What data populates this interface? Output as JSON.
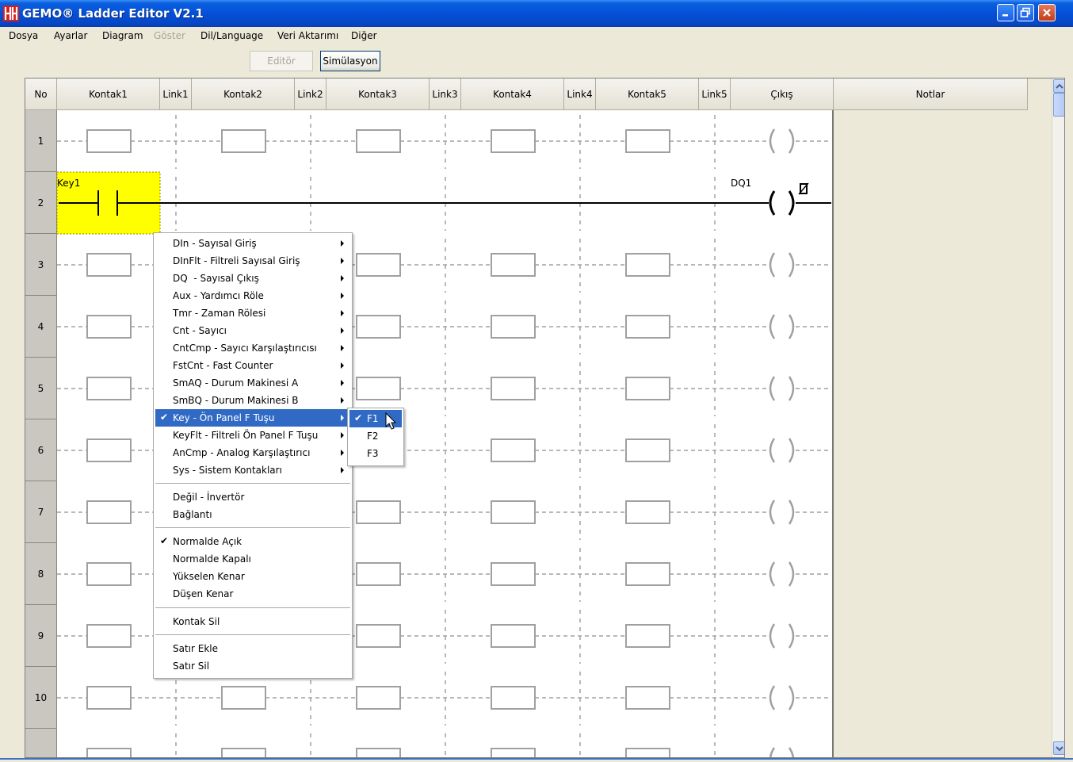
{
  "window": {
    "title": "GEMO® Ladder Editor V2.1"
  },
  "menubar": {
    "items": [
      {
        "label": "Dosya",
        "enabled": true
      },
      {
        "label": "Ayarlar",
        "enabled": true
      },
      {
        "label": "Diagram",
        "enabled": true
      },
      {
        "label": "Göster",
        "enabled": false
      },
      {
        "label": "Dil/Language",
        "enabled": true
      },
      {
        "label": "Veri Aktarımı",
        "enabled": true
      },
      {
        "label": "Diğer",
        "enabled": true
      }
    ]
  },
  "toolbar": {
    "editor_label": "Editör",
    "editor_enabled": false,
    "simulation_label": "Simülasyon"
  },
  "grid": {
    "headers": [
      "No",
      "Kontak1",
      "Link1",
      "Kontak2",
      "Link2",
      "Kontak3",
      "Link3",
      "Kontak4",
      "Link4",
      "Kontak5",
      "Link5",
      "Çıkış",
      "Notlar"
    ],
    "rows": [
      "1",
      "2",
      "3",
      "4",
      "5",
      "6",
      "7",
      "8",
      "9",
      "10"
    ],
    "row2": {
      "contact_label": "Key1",
      "output_label": "DQ1",
      "contact_highlight": "#ffff00"
    }
  },
  "context_menu": {
    "items": [
      {
        "label": "DIn - Sayısal Giriş",
        "submenu": true
      },
      {
        "label": "DInFlt - Filtreli Sayısal Giriş",
        "submenu": true
      },
      {
        "label": "DQ  - Sayısal Çıkış",
        "submenu": true
      },
      {
        "label": "Aux - Yardımcı Röle",
        "submenu": true
      },
      {
        "label": "Tmr - Zaman Rölesi",
        "submenu": true
      },
      {
        "label": "Cnt - Sayıcı",
        "submenu": true
      },
      {
        "label": "CntCmp - Sayıcı Karşılaştırıcısı",
        "submenu": true
      },
      {
        "label": "FstCnt - Fast Counter",
        "submenu": true
      },
      {
        "label": "SmAQ - Durum Makinesi A",
        "submenu": true
      },
      {
        "label": "SmBQ - Durum Makinesi B",
        "submenu": true
      },
      {
        "label": "Key - Ön Panel F Tuşu",
        "submenu": true,
        "checked": true,
        "highlighted": true
      },
      {
        "label": "KeyFlt - Filtreli Ön Panel F Tuşu",
        "submenu": true
      },
      {
        "label": "AnCmp - Analog Karşılaştırıcı",
        "submenu": true
      },
      {
        "label": "Sys - Sistem Kontakları",
        "submenu": true
      },
      {
        "label": "Değil - İnvertör"
      },
      {
        "label": "Bağlantı"
      },
      {
        "label": "Normalde Açık",
        "checked": true
      },
      {
        "label": "Normalde Kapalı"
      },
      {
        "label": "Yükselen Kenar"
      },
      {
        "label": "Düşen Kenar"
      },
      {
        "label": "Kontak Sil"
      },
      {
        "label": "Satır Ekle"
      },
      {
        "label": "Satır Sil"
      }
    ]
  },
  "submenu": {
    "items": [
      {
        "label": "F1",
        "checked": true,
        "highlighted": true
      },
      {
        "label": "F2"
      },
      {
        "label": "F3"
      }
    ]
  },
  "colors": {
    "title_bar": "#0550d8",
    "highlight": "#316ac5",
    "contact_highlight": "#ffff00",
    "placeholder_gray": "#a0a0a0"
  },
  "icons": [
    "app-logo-icon",
    "minimize-icon",
    "restore-icon",
    "close-icon",
    "submenu-arrow-icon",
    "checkmark-icon",
    "scroll-up-icon",
    "scroll-down-icon",
    "mouse-cursor-icon"
  ]
}
